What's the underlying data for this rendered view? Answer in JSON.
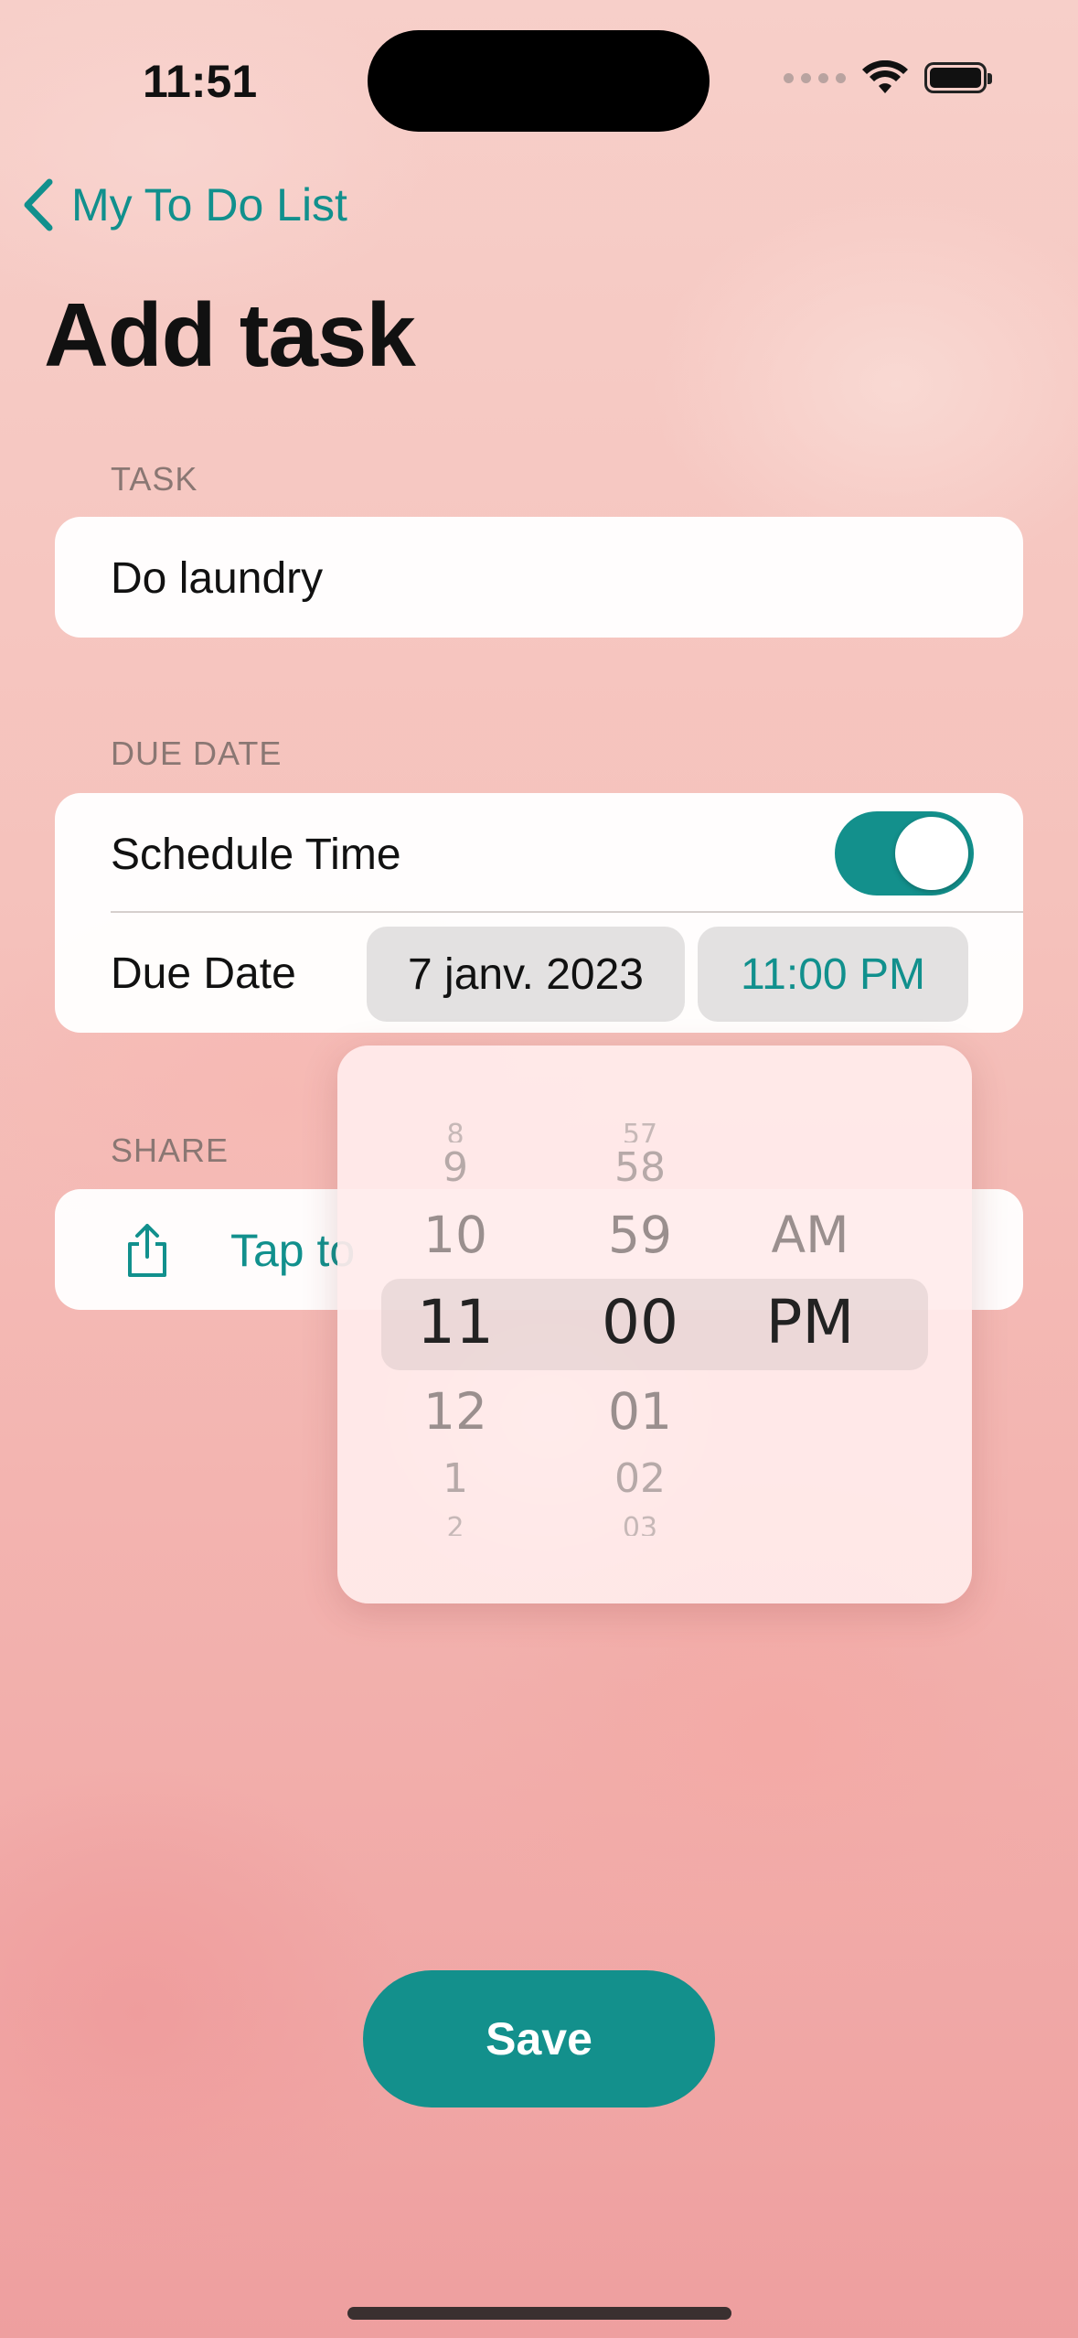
{
  "status_bar": {
    "time": "11:51"
  },
  "nav": {
    "back_label": "My To Do List"
  },
  "page": {
    "title": "Add task"
  },
  "task_section": {
    "label": "TASK",
    "value": "Do laundry"
  },
  "due_section": {
    "label": "DUE DATE",
    "schedule_label": "Schedule Time",
    "schedule_enabled": true,
    "due_label": "Due Date",
    "date_value": "7 janv. 2023",
    "time_value": "11:00 PM"
  },
  "share_section": {
    "label": "SHARE",
    "action_label": "Tap to"
  },
  "time_picker": {
    "hours": {
      "edge_above": "8",
      "far_above": "9",
      "near_above": "10",
      "selected": "11",
      "near_below": "12",
      "far_below": "1",
      "edge_below": "2"
    },
    "minutes": {
      "edge_above": "57",
      "far_above": "58",
      "near_above": "59",
      "selected": "00",
      "near_below": "01",
      "far_below": "02",
      "edge_below": "03"
    },
    "period": {
      "near_above": "AM",
      "selected": "PM"
    }
  },
  "footer": {
    "save_label": "Save"
  },
  "colors": {
    "accent": "#13908c",
    "background": "#f5c1bb"
  }
}
